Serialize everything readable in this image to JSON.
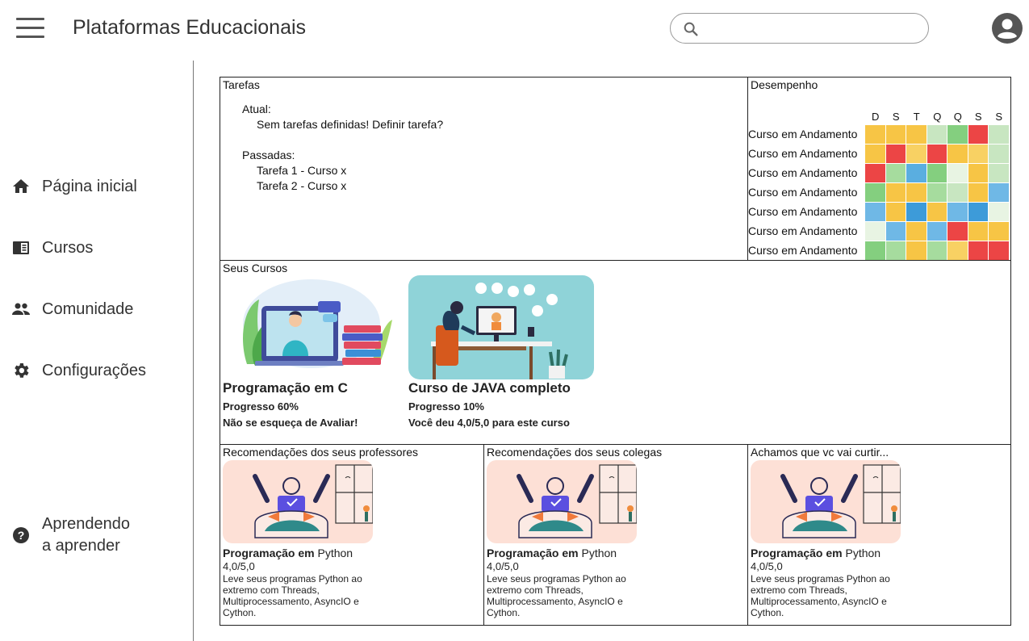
{
  "header": {
    "title": "Plataformas Educacionais",
    "search_placeholder": "",
    "menu_icon": "hamburger-menu-icon",
    "search_icon": "search-icon",
    "avatar_icon": "account-circle-icon"
  },
  "sidebar": {
    "items": [
      {
        "label": "Página inicial",
        "icon": "home-icon"
      },
      {
        "label": "Cursos",
        "icon": "menu-book-icon"
      },
      {
        "label": "Comunidade",
        "icon": "people-icon"
      },
      {
        "label": "Configurações",
        "icon": "gear-icon"
      }
    ],
    "help": {
      "line1": "Aprendendo",
      "line2": "a aprender",
      "icon": "help-circle-icon"
    }
  },
  "tarefas": {
    "title": "Tarefas",
    "current_label": "Atual:",
    "current_item": "Sem tarefas definidas! Definir tarefa?",
    "past_label": "Passadas:",
    "past_items": [
      "Tarefa 1 - Curso x",
      "Tarefa 2 - Curso x"
    ]
  },
  "desempenho": {
    "title": "Desempenho",
    "days": [
      "D",
      "S",
      "T",
      "Q",
      "Q",
      "S",
      "S"
    ],
    "row_labels": [
      "Curso em Andamento",
      "Curso em Andamento",
      "Curso em Andamento",
      "Curso em Andamento",
      "Curso em Andamento",
      "Curso em Andamento",
      "Curso em Andamento"
    ],
    "palette": {
      "yellow": "#f7c545",
      "red": "#ec4545",
      "lightgreen": "#c8e6c1",
      "green": "#84cf7f",
      "paleyellow": "#f8d163",
      "blue": "#5aaee0",
      "paleblue": "#6fb8e6",
      "palest": "#e8f4e3",
      "midgreen": "#a6dc9e",
      "deepblue": "#3d9bd9"
    },
    "grid": [
      [
        "yellow",
        "yellow",
        "yellow",
        "lightgreen",
        "green",
        "red",
        "lightgreen"
      ],
      [
        "yellow",
        "red",
        "paleyellow",
        "red",
        "yellow",
        "paleyellow",
        "lightgreen"
      ],
      [
        "red",
        "midgreen",
        "blue",
        "green",
        "palest",
        "yellow",
        "lightgreen"
      ],
      [
        "green",
        "yellow",
        "yellow",
        "midgreen",
        "lightgreen",
        "yellow",
        "paleblue"
      ],
      [
        "paleblue",
        "yellow",
        "deepblue",
        "yellow",
        "paleblue",
        "deepblue",
        "palest"
      ],
      [
        "palest",
        "paleblue",
        "yellow",
        "paleblue",
        "red",
        "yellow",
        "yellow"
      ],
      [
        "green",
        "midgreen",
        "yellow",
        "midgreen",
        "paleyellow",
        "red",
        "red"
      ]
    ]
  },
  "seus_cursos": {
    "title": "Seus Cursos",
    "courses": [
      {
        "title": "Programação em C",
        "line1": "Progresso 60%",
        "line2": "Não se esqueça de Avaliar!"
      },
      {
        "title": "Curso de JAVA completo",
        "line1": "Progresso 10%",
        "line2": "Você deu 4,0/5,0 para este curso"
      }
    ]
  },
  "recomendacoes": [
    {
      "title": "Recomendações dos seus professores",
      "name_bold": "Programação em",
      "name_rest": " Python",
      "rating": "4,0/5,0",
      "desc": "Leve seus programas Python ao extremo com Threads, Multiprocessamento, AsyncIO e Cython."
    },
    {
      "title": "Recomendações dos seus colegas",
      "name_bold": "Programação em",
      "name_rest": " Python",
      "rating": "4,0/5,0",
      "desc": "Leve seus programas Python ao extremo com Threads, Multiprocessamento, AsyncIO e Cython."
    },
    {
      "title": "Achamos que vc vai curtir...",
      "name_bold": "Programação em",
      "name_rest": " Python",
      "rating": "4,0/5,0",
      "desc": "Leve seus programas Python ao extremo com Threads, Multiprocessamento, AsyncIO e Cython."
    }
  ]
}
